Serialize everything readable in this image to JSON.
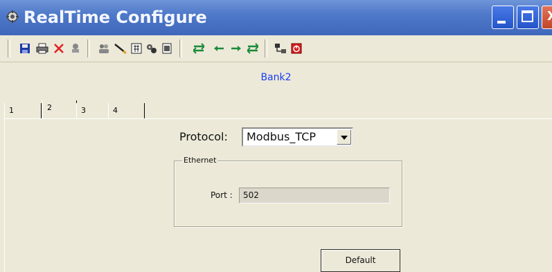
{
  "window": {
    "title": "RealTime Configure",
    "controls": {
      "minimize": "minimize",
      "maximize": "maximize",
      "close": "X"
    },
    "colors": {
      "titlebar": "#4f79c9",
      "accent_text": "#1a3df0"
    }
  },
  "toolbar": {
    "tools": [
      {
        "name": "save",
        "icon": "floppy-disk-icon"
      },
      {
        "name": "print",
        "icon": "printer-icon"
      },
      {
        "name": "delete",
        "icon": "red-x-icon"
      },
      {
        "name": "tool",
        "icon": "stamp-icon"
      },
      {
        "name": "users",
        "icon": "people-icon"
      },
      {
        "name": "draw",
        "icon": "pencil-icon"
      },
      {
        "name": "calculator",
        "icon": "calculator-icon"
      },
      {
        "name": "settings",
        "icon": "gears-icon"
      },
      {
        "name": "document",
        "icon": "document-icon"
      },
      {
        "name": "move-left-right",
        "icon": "green-double-arrow-icon"
      },
      {
        "name": "move-left",
        "icon": "green-left-arrow-icon"
      },
      {
        "name": "move-right",
        "icon": "green-right-arrow-icon"
      },
      {
        "name": "move-right-left",
        "icon": "green-double-arrow-icon"
      },
      {
        "name": "network",
        "icon": "network-icon"
      },
      {
        "name": "power",
        "icon": "red-power-icon"
      }
    ]
  },
  "bank": {
    "title": "Bank2"
  },
  "tabs": [
    {
      "label": "1",
      "active": false
    },
    {
      "label": "2",
      "active": true
    },
    {
      "label": "3",
      "active": false
    },
    {
      "label": "4",
      "active": false
    }
  ],
  "protocol": {
    "label": "Protocol:",
    "value": "Modbus_TCP"
  },
  "ethernet": {
    "legend": "Ethernet",
    "port_label": "Port :",
    "port_value": "502"
  },
  "actions": {
    "default_label": "Default"
  }
}
